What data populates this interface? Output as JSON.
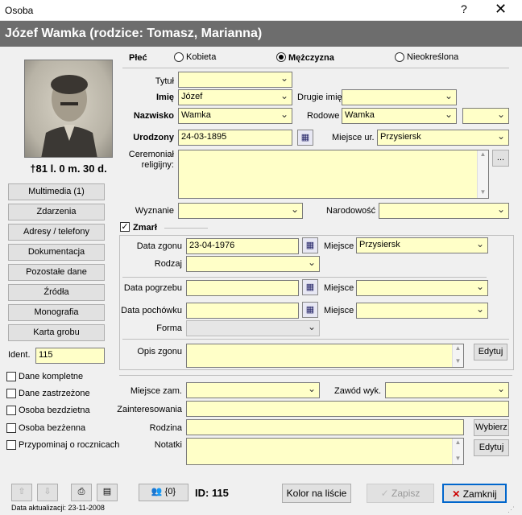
{
  "window": {
    "title": "Osoba",
    "help": "?",
    "close": "✕"
  },
  "header": {
    "name": "Józef Wamka (rodzice: Tomasz, Marianna)"
  },
  "left": {
    "age": "†81 l. 0 m. 30 d.",
    "buttons": [
      "Multimedia (1)",
      "Zdarzenia",
      "Adresy / telefony",
      "Dokumentacja",
      "Pozostałe dane",
      "Źródła",
      "Monografia",
      "Karta grobu"
    ],
    "ident_label": "Ident.",
    "ident_value": "115",
    "checks": [
      "Dane kompletne",
      "Dane zastrzeżone",
      "Osoba bezdzietna",
      "Osoba bezżenna",
      "Przypominaj o rocznicach"
    ]
  },
  "gender": {
    "label": "Płeć",
    "options": [
      "Kobieta",
      "Mężczyzna",
      "Nieokreślona"
    ],
    "selected": "Mężczyzna"
  },
  "form": {
    "tytul": {
      "label": "Tytuł",
      "value": ""
    },
    "imie": {
      "label": "Imię",
      "value": "Józef"
    },
    "drugie_imie": {
      "label": "Drugie imię",
      "value": ""
    },
    "nazwisko": {
      "label": "Nazwisko",
      "value": "Wamka"
    },
    "rodowe": {
      "label": "Rodowe",
      "value": "Wamka"
    },
    "urodzony": {
      "label": "Urodzony",
      "value": "24-03-1895"
    },
    "miejsce_ur": {
      "label": "Miejsce ur.",
      "value": "Przysiersk"
    },
    "ceremonial": {
      "label": "Ceremoniał religijny:",
      "value": "",
      "button": "..."
    },
    "wyznanie": {
      "label": "Wyznanie",
      "value": ""
    },
    "narodowosc": {
      "label": "Narodowość",
      "value": ""
    }
  },
  "death": {
    "checkbox_label": "Zmarł",
    "checked": true,
    "data_zgonu": {
      "label": "Data zgonu",
      "value": "23-04-1976"
    },
    "miejsce_zgonu": {
      "label": "Miejsce",
      "value": "Przysiersk"
    },
    "rodzaj": {
      "label": "Rodzaj",
      "value": ""
    },
    "data_pogrzebu": {
      "label": "Data pogrzebu",
      "value": ""
    },
    "miejsce_pogrzebu": {
      "label": "Miejsce",
      "value": ""
    },
    "data_pochowku": {
      "label": "Data pochówku",
      "value": ""
    },
    "miejsce_pochowku": {
      "label": "Miejsce",
      "value": ""
    },
    "forma": {
      "label": "Forma",
      "value": ""
    },
    "opis_zgonu": {
      "label": "Opis zgonu",
      "value": "",
      "button": "Edytuj"
    }
  },
  "other": {
    "miejsce_zam": {
      "label": "Miejsce zam.",
      "value": ""
    },
    "zawod": {
      "label": "Zawód wyk.",
      "value": ""
    },
    "zainteresowania": {
      "label": "Zainteresowania",
      "value": ""
    },
    "rodzina": {
      "label": "Rodzina",
      "value": "",
      "button": "Wybierz"
    },
    "notatki": {
      "label": "Notatki",
      "value": "",
      "button": "Edytuj"
    }
  },
  "footer": {
    "count_label": "{0}",
    "id_label": "ID: 115",
    "color_button": "Kolor na liście",
    "save_button": "Zapisz",
    "close_button": "Zamknij",
    "updated": "Data aktualizacji: 23-11-2008"
  },
  "colors": {
    "field_bg": "#ffffc8",
    "header_bg": "#6d6d6d",
    "close_x": "#cc0000"
  }
}
